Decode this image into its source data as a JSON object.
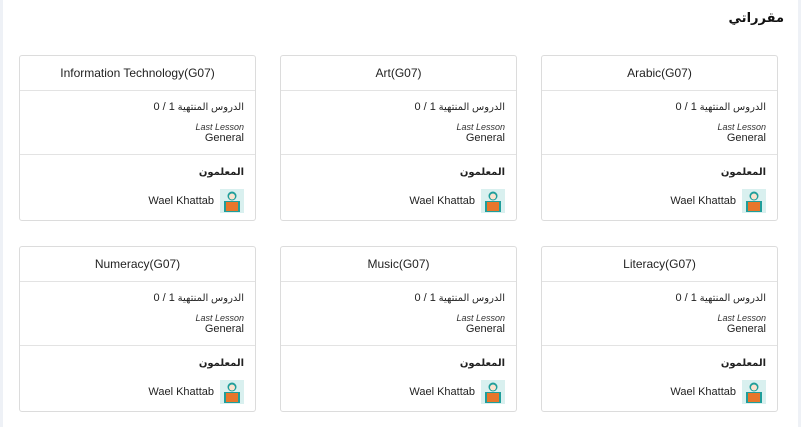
{
  "page": {
    "title": "مقرراتي"
  },
  "labels": {
    "lessons": "الدروس المنتهية",
    "last_lesson": "Last Lesson",
    "teachers": "المعلمون"
  },
  "courses": [
    {
      "name": "Arabic(G07)",
      "progress": "1 / 0",
      "last_lesson": "General",
      "teacher": "Wael Khattab"
    },
    {
      "name": "Art(G07)",
      "progress": "1 / 0",
      "last_lesson": "General",
      "teacher": "Wael Khattab"
    },
    {
      "name": "Information Technology(G07)",
      "progress": "1 / 0",
      "last_lesson": "General",
      "teacher": "Wael Khattab"
    },
    {
      "name": "Literacy(G07)",
      "progress": "1 / 0",
      "last_lesson": "General",
      "teacher": "Wael Khattab"
    },
    {
      "name": "Music(G07)",
      "progress": "1 / 0",
      "last_lesson": "General",
      "teacher": "Wael Khattab"
    },
    {
      "name": "Numeracy(G07)",
      "progress": "1 / 0",
      "last_lesson": "General",
      "teacher": "Wael Khattab"
    }
  ],
  "icons": {
    "teacher_avatar": "teacher-avatar-icon"
  },
  "colors": {
    "avatar_body": "#e8762b",
    "avatar_bg": "#1f9e9a"
  }
}
